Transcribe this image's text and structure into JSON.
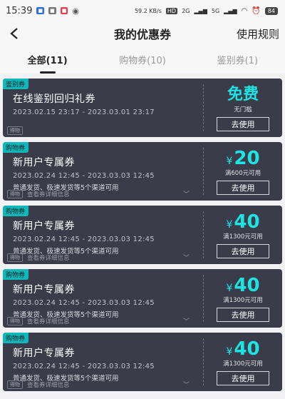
{
  "status_bar": {
    "time": "15:39",
    "speed": "59.2 KB/s",
    "network": "2G",
    "network2": "5G",
    "battery": "84"
  },
  "header": {
    "title": "我的优惠券",
    "rules_label": "使用规则"
  },
  "tabs": [
    {
      "label": "全部(11)",
      "active": true
    },
    {
      "label": "购物券(10)",
      "active": false
    },
    {
      "label": "鉴别券(1)",
      "active": false
    }
  ],
  "coupons": [
    {
      "type": "鉴别券",
      "title": "在线鉴别回归礼券",
      "date": "2023.02.15 23:17 - 2023.03.01 23:17",
      "desc": "",
      "chip": "得物",
      "detail": "",
      "amount_label": "免费",
      "condition": "无门槛",
      "button": "去使用"
    },
    {
      "type": "购物券",
      "title": "新用户专属券",
      "date": "2023.02.24 12:45 - 2023.03.03 12:45",
      "desc": "普通发货、极速发货等5个渠道可用",
      "chip": "得物",
      "detail": "查看券详细信息",
      "currency": "¥",
      "amount": "20",
      "condition": "满600元可用",
      "button": "去使用"
    },
    {
      "type": "购物券",
      "title": "新用户专属券",
      "date": "2023.02.24 12:45 - 2023.03.03 12:45",
      "desc": "普通发货、极速发货等5个渠道可用",
      "chip": "得物",
      "detail": "查看券详细信息",
      "currency": "¥",
      "amount": "40",
      "condition": "满1300元可用",
      "button": "去使用"
    },
    {
      "type": "购物券",
      "title": "新用户专属券",
      "date": "2023.02.24 12:45 - 2023.03.03 12:45",
      "desc": "普通发货、极速发货等5个渠道可用",
      "chip": "得物",
      "detail": "查看券详细信息",
      "currency": "¥",
      "amount": "40",
      "condition": "满1300元可用",
      "button": "去使用"
    },
    {
      "type": "购物券",
      "title": "新用户专属券",
      "date": "2023.02.24 12:45 - 2023.03.03 12:45",
      "desc": "普通发货、极速发货等5个渠道可用",
      "chip": "得物",
      "detail": "查看券详细信息",
      "currency": "¥",
      "amount": "40",
      "condition": "满1300元可用",
      "button": "去使用"
    }
  ],
  "colors": {
    "accent": "#1ee3e3",
    "tag": "#0fb8b8",
    "card": "#3b3c4a"
  }
}
